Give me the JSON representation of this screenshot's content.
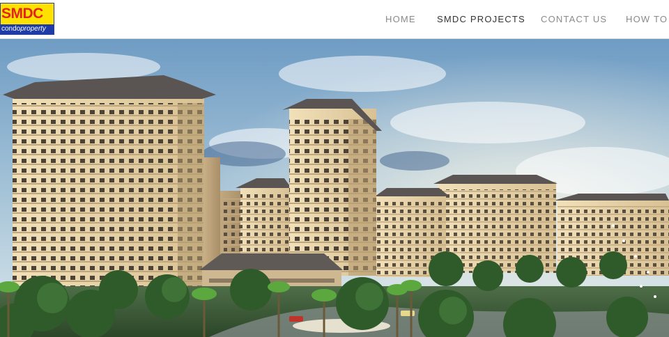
{
  "brand": {
    "logo_top": "SMDC",
    "logo_bottom_a": "condo",
    "logo_bottom_b": "property"
  },
  "nav": {
    "items": [
      {
        "label": "HOME",
        "active": false
      },
      {
        "label": "SMDC PROJECTS",
        "active": true
      },
      {
        "label": "CONTACT US",
        "active": false
      },
      {
        "label": "HOW TO",
        "active": false
      }
    ]
  },
  "hero": {
    "image": "condominium-towers-rendering",
    "colors": {
      "sky_top": "#6f9cc4",
      "sky_bottom": "#dce8ec",
      "building": "#e7d3a8",
      "trim": "#b59b6f",
      "roof": "#5a5552",
      "foliage": "#2f5a2a"
    }
  }
}
